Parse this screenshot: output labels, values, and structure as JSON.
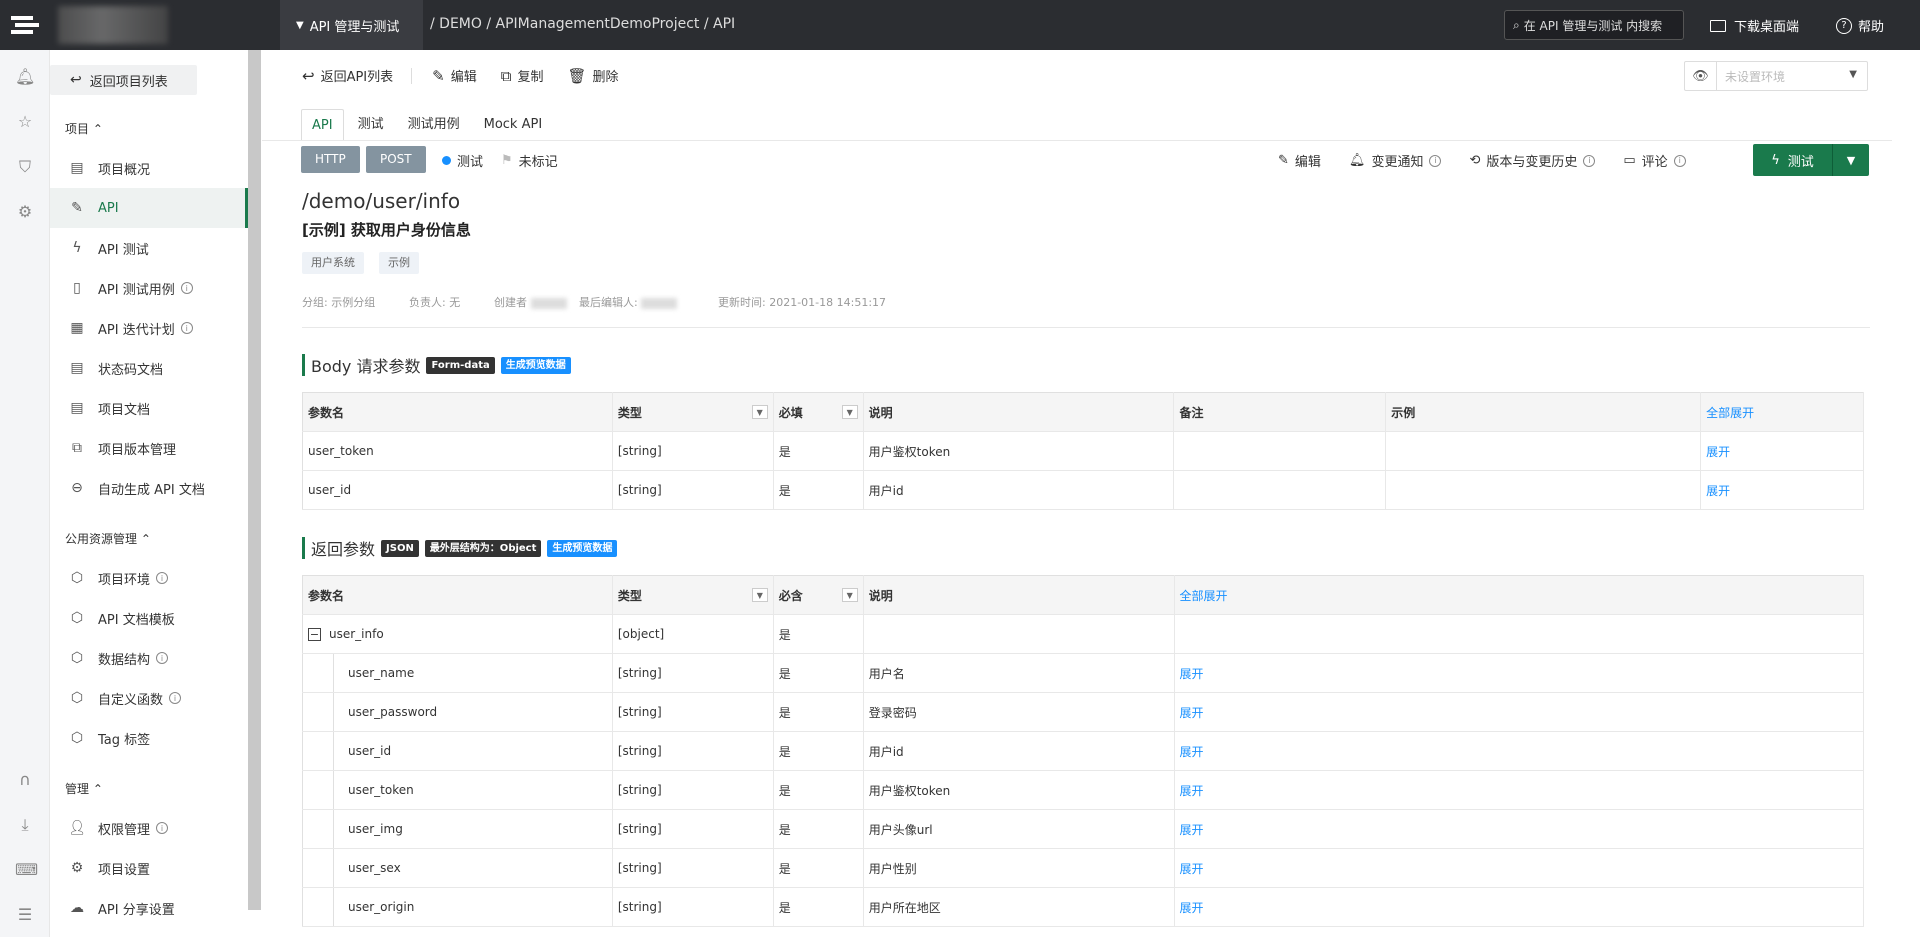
{
  "topbar": {
    "module": "API 管理与测试",
    "breadcrumb": "/ DEMO / APIManagementDemoProject / API",
    "search_placeholder": "在 API 管理与测试 内搜索",
    "download": "下载桌面端",
    "help": "帮助"
  },
  "rail": {
    "icons": [
      "bell-icon",
      "star-icon",
      "shirt-icon",
      "gear-icon",
      "headset-icon",
      "download-icon",
      "keyboard-icon",
      "list-icon"
    ]
  },
  "sidebar": {
    "back": "返回项目列表",
    "sections": [
      {
        "title": "项目",
        "items": [
          {
            "label": "项目概况",
            "icon": "overview-icon"
          },
          {
            "label": "API",
            "icon": "api-icon",
            "active": true
          },
          {
            "label": "API 测试",
            "icon": "flash-icon"
          },
          {
            "label": "API 测试用例",
            "icon": "testcase-icon",
            "info": true
          },
          {
            "label": "API 迭代计划",
            "icon": "calendar-icon",
            "info": true
          },
          {
            "label": "状态码文档",
            "icon": "status-doc-icon"
          },
          {
            "label": "项目文档",
            "icon": "doc-icon"
          },
          {
            "label": "项目版本管理",
            "icon": "version-icon"
          },
          {
            "label": "自动生成 API 文档",
            "icon": "robot-icon"
          }
        ]
      },
      {
        "title": "公用资源管理",
        "items": [
          {
            "label": "项目环境",
            "icon": "cube-icon",
            "info": true
          },
          {
            "label": "API 文档模板",
            "icon": "cube-icon"
          },
          {
            "label": "数据结构",
            "icon": "cube-icon",
            "info": true
          },
          {
            "label": "自定义函数",
            "icon": "cube-icon",
            "info": true
          },
          {
            "label": "Tag 标签",
            "icon": "cube-icon"
          }
        ]
      },
      {
        "title": "管理",
        "items": [
          {
            "label": "权限管理",
            "icon": "user-icon",
            "info": true
          },
          {
            "label": "项目设置",
            "icon": "settings-icon"
          },
          {
            "label": "API 分享设置",
            "icon": "cloud-icon"
          }
        ]
      }
    ]
  },
  "actions": {
    "back": "返回API列表",
    "edit": "编辑",
    "copy": "复制",
    "delete": "删除"
  },
  "env_select": {
    "placeholder": "未设置环境"
  },
  "tabs": [
    "API",
    "测试",
    "测试用例",
    "Mock API"
  ],
  "api": {
    "protocol": "HTTP",
    "method": "POST",
    "status": "测试",
    "mark": "未标记",
    "path": "/demo/user/info",
    "name": "[示例] 获取用户身份信息",
    "tags": [
      "用户系统",
      "示例"
    ],
    "group": "分组: 示例分组",
    "owner": "负责人: 无",
    "creator": "创建者",
    "last_editor": "最后编辑人:",
    "updated": "更新时间: 2021-01-18 14:51:17"
  },
  "right_actions": {
    "edit": "编辑",
    "notify": "变更通知",
    "history": "版本与变更历史",
    "comment": "评论",
    "test": "测试"
  },
  "body_params": {
    "title": "Body 请求参数",
    "badge1": "Form-data",
    "badge2": "生成预览数据",
    "headers": [
      "参数名",
      "类型",
      "必填",
      "说明",
      "备注",
      "示例",
      "全部展开"
    ],
    "rows": [
      {
        "name": "user_token",
        "type": "[string]",
        "required": "是",
        "desc": "用户鉴权token",
        "remark": "",
        "example": "",
        "action": "展开"
      },
      {
        "name": "user_id",
        "type": "[string]",
        "required": "是",
        "desc": "用户id",
        "remark": "",
        "example": "",
        "action": "展开"
      }
    ]
  },
  "return_params": {
    "title": "返回参数",
    "badge1": "JSON",
    "badge2": "最外层结构为：Object",
    "badge3": "生成预览数据",
    "headers": [
      "参数名",
      "类型",
      "必含",
      "说明",
      "全部展开"
    ],
    "parent": {
      "name": "user_info",
      "type": "[object]",
      "required": "是",
      "desc": ""
    },
    "rows": [
      {
        "name": "user_name",
        "type": "[string]",
        "required": "是",
        "desc": "用户名",
        "action": "展开"
      },
      {
        "name": "user_password",
        "type": "[string]",
        "required": "是",
        "desc": "登录密码",
        "action": "展开"
      },
      {
        "name": "user_id",
        "type": "[string]",
        "required": "是",
        "desc": "用户id",
        "action": "展开"
      },
      {
        "name": "user_token",
        "type": "[string]",
        "required": "是",
        "desc": "用户鉴权token",
        "action": "展开"
      },
      {
        "name": "user_img",
        "type": "[string]",
        "required": "是",
        "desc": "用户头像url",
        "action": "展开"
      },
      {
        "name": "user_sex",
        "type": "[string]",
        "required": "是",
        "desc": "用户性别",
        "action": "展开"
      },
      {
        "name": "user_origin",
        "type": "[string]",
        "required": "是",
        "desc": "用户所在地区",
        "action": "展开"
      }
    ]
  },
  "colors": {
    "brand": "#1a7a4c",
    "link": "#1890ff",
    "topbar": "#2b2d31"
  }
}
